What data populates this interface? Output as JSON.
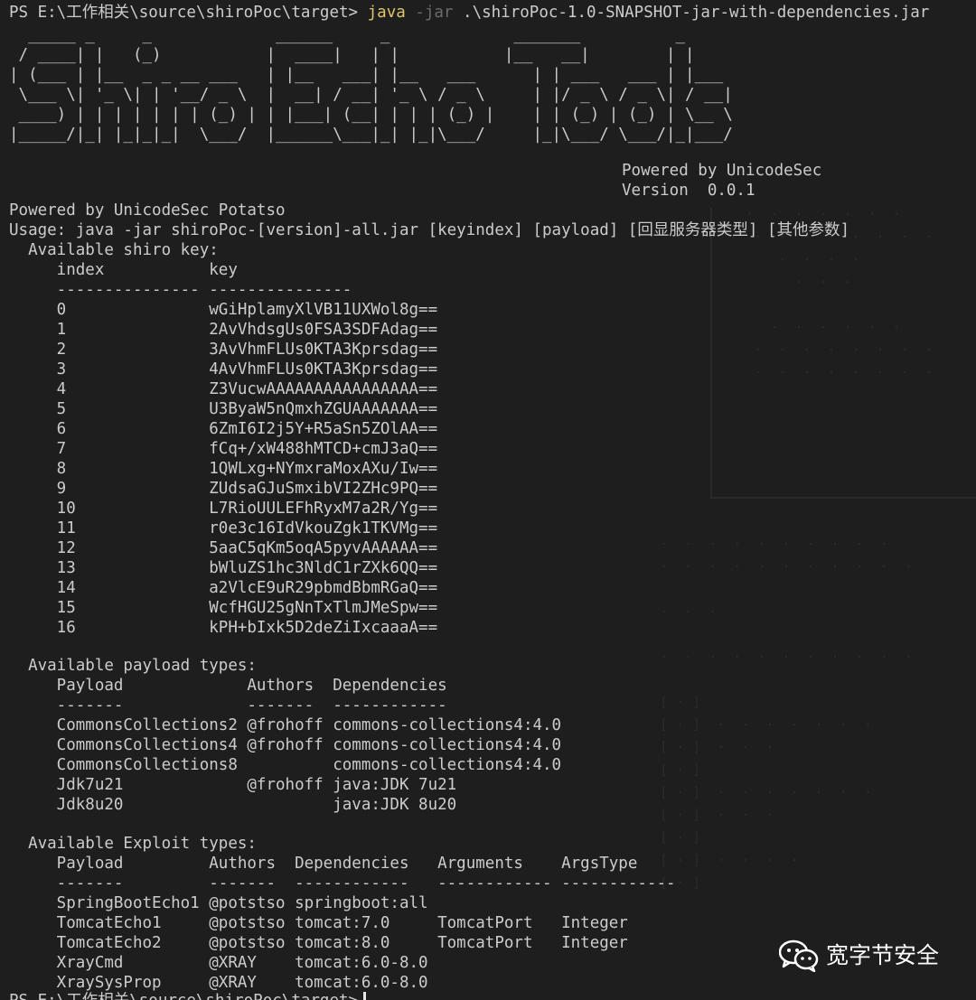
{
  "terminal": {
    "prompt": "PS E:\\工作相关\\source\\shiroPoc\\target>",
    "command": "java",
    "flag": "-jar",
    "jar_path": ".\\shiroPoc-1.0-SNAPSHOT-jar-with-dependencies.jar",
    "banner_art": "  _____ _     _             ______     _             _______          _     \n / ____| |   (_)           |  ____|   | |           |__   __|        | |    \n| (___ | |__  _ _ __ ___   | |__   ___| |__   ___      | | ___   ___ | |___ \n \\___ \\| '_ \\| | '__/ _ \\  |  __| / __| '_ \\ / _ \\     | |/ _ \\ / _ \\| / __|\n ____) | | | | | | | (_) | | |___| (__| | | | (_) |    | | (_) | (_) | \\__ \\\n|_____/|_| |_|_|_|  \\___/  |______\\___|_| |_|\\___/     |_|\\___/ \\___/|_|___/",
    "powered_by_right": "Powered by UnicodeSec",
    "version_line": "Version  0.0.1",
    "powered_by": "Powered by UnicodeSec Potatso",
    "usage": "Usage: java -jar shiroPoc-[version]-all.jar [keyindex] [payload] [回显服务器类型] [其他参数]",
    "keys_title": "  Available shiro key:",
    "keys_header": "     index           key",
    "keys_divider": "     --------------- ---------------",
    "keys": [
      "     0               wGiHplamyXlVB11UXWol8g==",
      "     1               2AvVhdsgUs0FSA3SDFAdag==",
      "     2               3AvVhmFLUs0KTA3Kprsdag==",
      "     3               4AvVhmFLUs0KTA3Kprsdag==",
      "     4               Z3VucwAAAAAAAAAAAAAAAA==",
      "     5               U3ByaW5nQmxhZGUAAAAAAA==",
      "     6               6ZmI6I2j5Y+R5aSn5ZOlAA==",
      "     7               fCq+/xW488hMTCD+cmJ3aQ==",
      "     8               1QWLxg+NYmxraMoxAXu/Iw==",
      "     9               ZUdsaGJuSmxibVI2ZHc9PQ==",
      "     10              L7RioUULEFhRyxM7a2R/Yg==",
      "     11              r0e3c16IdVkouZgk1TKVMg==",
      "     12              5aaC5qKm5oqA5pyvAAAAAA==",
      "     13              bWluZS1hc3NldC1rZXk6QQ==",
      "     14              a2VlcE9uR29pbmdBbmRGaQ==",
      "     15              WcfHGU25gNnTxTlmJMeSpw==",
      "     16              kPH+bIxk5D2deZiIxcaaaA=="
    ],
    "payload_title": "  Available payload types:",
    "payload_header": "     Payload             Authors  Dependencies",
    "payload_divider": "     -------             -------  ------------",
    "payloads": [
      "     CommonsCollections2 @frohoff commons-collections4:4.0",
      "     CommonsCollections4 @frohoff commons-collections4:4.0",
      "     CommonsCollections8          commons-collections4:4.0",
      "     Jdk7u21             @frohoff java:JDK 7u21",
      "     Jdk8u20                      java:JDK 8u20"
    ],
    "exploit_title": "  Available Exploit types:",
    "exploit_header": "     Payload         Authors  Dependencies   Arguments    ArgsType",
    "exploit_divider": "     -------         -------  ------------   ------------ ------------",
    "exploits": [
      "     SpringBootEcho1 @potstso springboot:all",
      "     TomcatEcho1     @potstso tomcat:7.0     TomcatPort   Integer",
      "     TomcatEcho2     @potstso tomcat:8.0     TomcatPort   Integer",
      "     XrayCmd         @XRAY    tomcat:6.0-8.0",
      "     XraySysProp     @XRAY    tomcat:6.0-8.0"
    ],
    "final_prompt": "PS E:\\工作相关\\source\\shiroPoc\\target>"
  },
  "watermark": {
    "text": "宽字节安全",
    "icon": "wechat-icon"
  },
  "colors": {
    "background": "#1e1e1e",
    "text": "#cccccc",
    "command": "#e0c46c",
    "flag": "#6b6b6b"
  }
}
